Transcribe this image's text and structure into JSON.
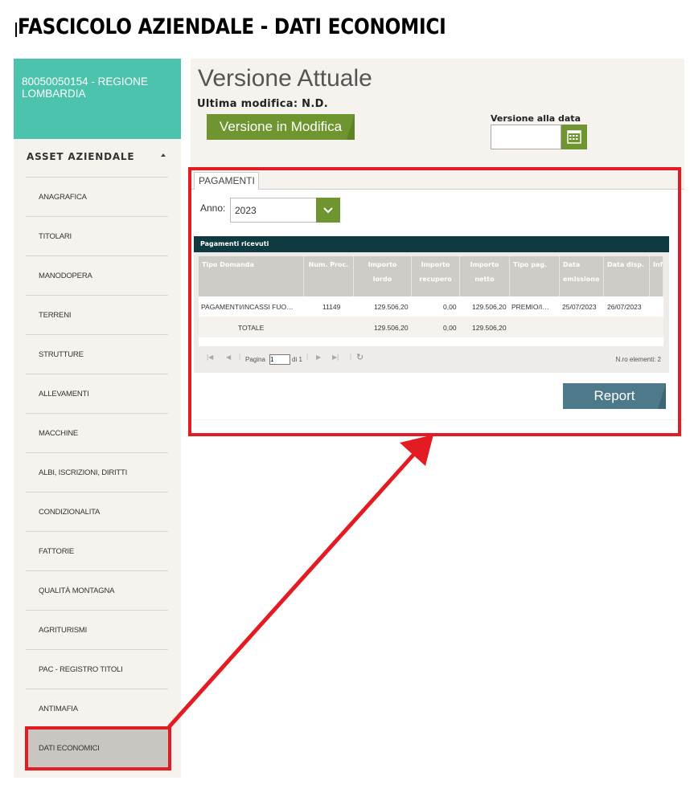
{
  "header": {
    "title": "FASCICOLO AZIENDALE - DATI ECONOMICI"
  },
  "sidebar": {
    "company": "80050050154 - REGIONE LOMBARDIA",
    "section_title": "ASSET AZIENDALE",
    "items": [
      {
        "label": "ANAGRAFICA"
      },
      {
        "label": "TITOLARI"
      },
      {
        "label": "MANODOPERA"
      },
      {
        "label": "TERRENI"
      },
      {
        "label": "STRUTTURE"
      },
      {
        "label": "ALLEVAMENTI"
      },
      {
        "label": "MACCHINE"
      },
      {
        "label": "ALBI, ISCRIZIONI, DIRITTI"
      },
      {
        "label": "CONDIZIONALITA"
      },
      {
        "label": "FATTORIE"
      },
      {
        "label": "QUALITÀ MONTAGNA"
      },
      {
        "label": "AGRITURISMI"
      },
      {
        "label": "PAC - REGISTRO TITOLI"
      },
      {
        "label": "ANTIMAFIA"
      },
      {
        "label": "DATI ECONOMICI"
      }
    ],
    "active_item": "DATI ECONOMICI"
  },
  "main": {
    "version_title": "Versione Attuale",
    "last_modified": "Ultima modifica: N.D.",
    "edit_button": "Versione in Modifica",
    "version_date_label": "Versione alla data",
    "version_date_value": "",
    "tab": "PAGAMENTI",
    "year_label": "Anno:",
    "year_value": "2023",
    "grid": {
      "title": "Pagamenti ricevuti",
      "columns": [
        {
          "line1": "Tipo Domanda",
          "line2": ""
        },
        {
          "line1": "Num. Proc.",
          "line2": ""
        },
        {
          "line1": "Importo",
          "line2": "lordo"
        },
        {
          "line1": "Importo",
          "line2": "recupero"
        },
        {
          "line1": "Importo",
          "line2": "netto"
        },
        {
          "line1": "Tipo pag.",
          "line2": ""
        },
        {
          "line1": "Data",
          "line2": "emissione"
        },
        {
          "line1": "Data disp.",
          "line2": ""
        },
        {
          "line1": "Inf",
          "line2": ""
        }
      ],
      "rows": [
        [
          "PAGAMENTI/INCASSI FUO…",
          "11149",
          "129.506,20",
          "0,00",
          "129.506,20",
          "PREMIO/I…",
          "25/07/2023",
          "26/07/2023",
          ""
        ]
      ],
      "total": {
        "label": "TOTALE",
        "lordo": "129.506,20",
        "recupero": "0,00",
        "netto": "129.506,20"
      },
      "pager": {
        "page_label": "Pagina",
        "page_value": "1",
        "of_label": "di 1",
        "count": "N.ro elementi: 2"
      }
    },
    "report_button": "Report"
  },
  "colors": {
    "accent_green": "#6e9530",
    "teal": "#4cc3ac",
    "grid_header": "#0f3a41",
    "annotation_red": "#e31b23"
  }
}
